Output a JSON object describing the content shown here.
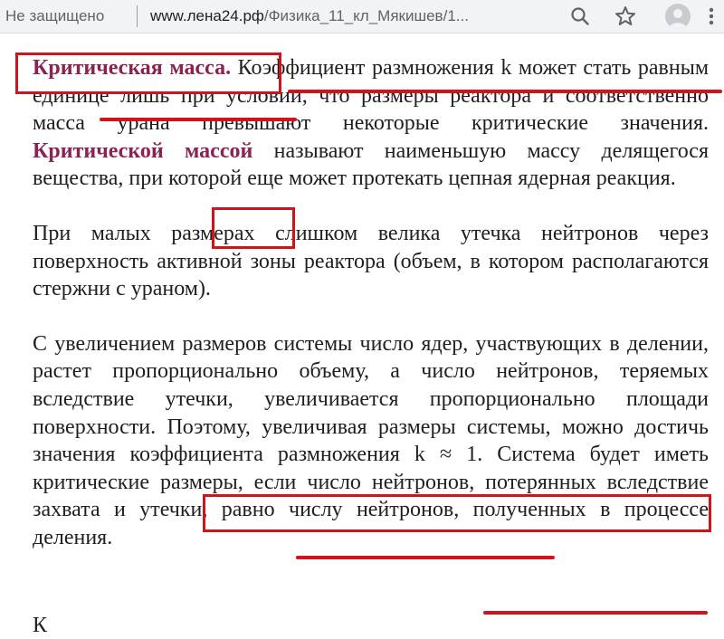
{
  "browser": {
    "security_label": "Не защищено",
    "url_host": "www.лена24.рф",
    "url_path": "/Физика_11_кл_Мякишев/1...",
    "icons": [
      "search-icon",
      "star-icon",
      "avatar-icon",
      "menu-icon"
    ]
  },
  "article": {
    "p1": {
      "term": "Критическая масса.",
      "s1": "Коэффициент размножения k может стать равным единице лишь при условии, что размеры реактора и соответственно масса урана превышают некоторые критические значения.",
      "term2": "Критической массой",
      "s2": "называют наименьшую массу делящегося вещества, при которой еще может протекать цепная ядерная реакция."
    },
    "p2": "При малых размерах слишком велика утечка нейтронов через поверхность активной зоны реактора (объем, в котором располагаются стержни с ураном).",
    "p3": "С увеличением размеров системы число ядер, участвующих в делении, растет пропорционально объему, а число нейтронов, теряемых вследствие утечки, увеличивается пропорционально площади поверхности. Поэтому, увеличивая размеры системы, можно достичь значения коэффициента размножения k ≈ 1. Система будет иметь критические размеры, если число нейтронов, потерянных вследствие захвата и утечки, равно числу нейтронов, полученных в процессе деления.",
    "cut_line": "К"
  },
  "colors": {
    "accent_term": "#8b2252",
    "annotation_red": "#d0141c",
    "text": "#1f1f1f"
  }
}
